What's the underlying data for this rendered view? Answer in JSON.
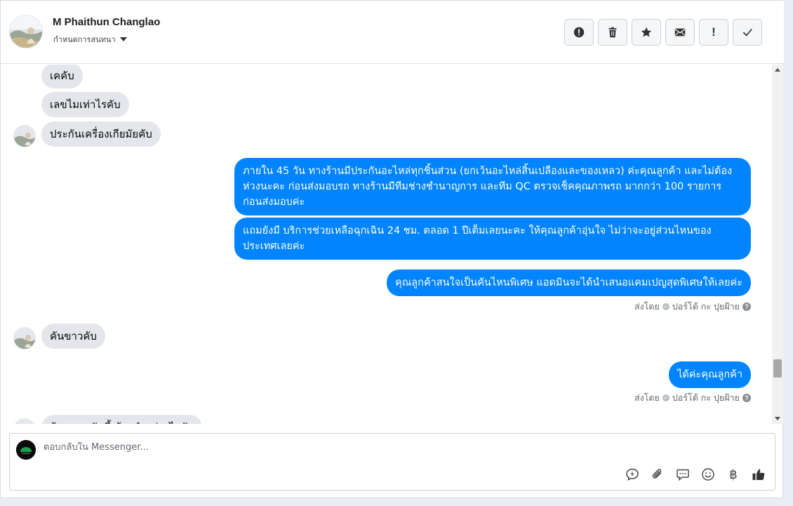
{
  "header": {
    "contact_name": "M Phaithun Changlao",
    "assign_label": "กำหนดการสนทนา",
    "toolbar": [
      {
        "name": "alert-circle-icon",
        "label": ""
      },
      {
        "name": "trash-icon",
        "label": ""
      },
      {
        "name": "star-icon",
        "label": ""
      },
      {
        "name": "envelope-icon",
        "label": ""
      },
      {
        "name": "exclamation-icon",
        "label": "!"
      },
      {
        "name": "checkmark-icon",
        "label": ""
      }
    ]
  },
  "messages": [
    {
      "side": "in",
      "text": "เคคับ"
    },
    {
      "side": "in",
      "text": "เลขไมเท่าไรคับ"
    },
    {
      "side": "in",
      "text": "ประกันเครื่องเกียมัยคับ"
    },
    {
      "side": "out",
      "text": "ภายใน 45 วัน ทางร้านมีประกันอะไหล่ทุกชิ้นส่วน (ยกเว้นอะไหล่สิ้นเปลืองและของเหลว) ค่ะคุณลูกค้า  และไม่ต้องห่วงนะคะ ก่อนส่งมอบรถ ทางร้านมีทีมช่างชำนาญการ และทีม QC ตรวจเช็คคุณภาพรถ มากกว่า 100 รายการ ก่อนส่งมอบค่ะ"
    },
    {
      "side": "out",
      "text": "แถมยังมี บริการช่วยเหลือฉุกเฉิน 24 ชม. ตลอด 1 ปีเต็มเลยนะคะ ให้คุณลูกค้าอุ่นใจ ไม่ว่าจะอยู่ส่วนไหนของประเทศเลยค่ะ"
    },
    {
      "side": "out",
      "text": "คุณลูกค้าสนใจเป็นคันไหนพิเศษ แอดมินจะได้นำเสนอแคมเปญสุดพิเศษให้เลยค่ะ"
    },
    {
      "side": "in",
      "text": "คันขาวคับ"
    },
    {
      "side": "out",
      "text": "ได้ค่ะคุณลูกค้า"
    },
    {
      "side": "in",
      "text": "ถ้าจะเอาคันนี้ ต้องทำอย่างไรคับ"
    }
  ],
  "sent_by": {
    "prefix": "ส่งโดย",
    "name": "ปอร์โต้ กะ ปุยฝ้าย",
    "help": "?"
  },
  "composer": {
    "placeholder": "ตอบกลับใน Messenger...",
    "tools": [
      "quick-reply-icon",
      "attachment-icon",
      "saved-replies-icon",
      "emoji-icon",
      "baht-icon",
      "thumbs-up-icon"
    ],
    "baht_symbol": "฿"
  }
}
